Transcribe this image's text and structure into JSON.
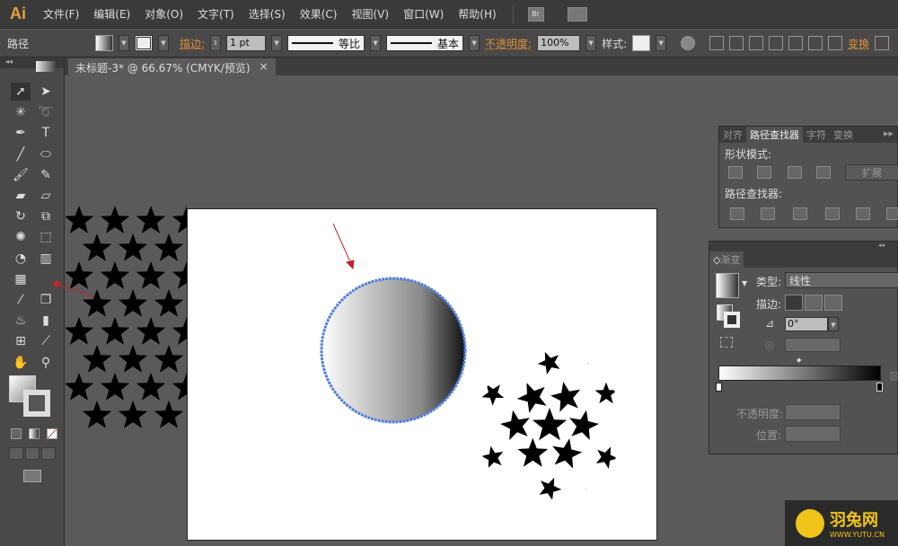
{
  "app": {
    "logo": "Ai"
  },
  "menu": [
    "文件(F)",
    "编辑(E)",
    "对象(O)",
    "文字(T)",
    "选择(S)",
    "效果(C)",
    "视图(V)",
    "窗口(W)",
    "帮助(H)"
  ],
  "menu_icons": {
    "bridge": "Br",
    "workspace": "arrange-documents-icon"
  },
  "control": {
    "selection_type": "路径",
    "stroke_label": "描边:",
    "stroke_weight": "1 pt",
    "profile": "等比",
    "brush": "基本",
    "opacity_label": "不透明度:",
    "opacity": "100%",
    "style_label": "样式:",
    "transform_link": "变换"
  },
  "document_tab": {
    "title": "未标题-3* @ 66.67% (CMYK/预览)",
    "close": "×"
  },
  "pathfinder_panel": {
    "tabs": [
      "对齐",
      "路径查找器",
      "字符",
      "变换"
    ],
    "active_tab": "路径查找器",
    "shape_modes_label": "形状模式:",
    "expand_button": "扩展",
    "pathfinders_label": "路径查找器:"
  },
  "gradient_panel": {
    "title": "渐变",
    "type_label": "类型:",
    "type_value": "线性",
    "stroke_label": "描边:",
    "angle": "0°",
    "opacity_label": "不透明度:",
    "location_label": "位置:",
    "gradient_stops": [
      {
        "color": "#ffffff",
        "location": 0
      },
      {
        "color": "#000000",
        "location": 100
      }
    ]
  },
  "colors": {
    "accent_orange": "#d8913a",
    "selection_blue": "#4f7fd8",
    "arrow_red": "#c0272d"
  },
  "watermark": {
    "brand": "羽兔网",
    "url": "WWW.YUTU.CN"
  }
}
